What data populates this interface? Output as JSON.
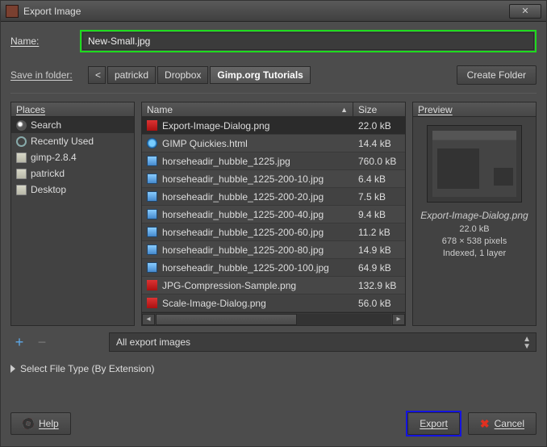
{
  "title": "Export Image",
  "name_label": "Name:",
  "name_value": "New-Small.jpg",
  "save_label": "Save in folder:",
  "breadcrumbs": [
    "patrickd",
    "Dropbox",
    "Gimp.org Tutorials"
  ],
  "create_folder": "Create Folder",
  "places_header": "Places",
  "places": [
    {
      "label": "Search",
      "icon": "search-icon"
    },
    {
      "label": "Recently Used",
      "icon": "recent-icon"
    },
    {
      "label": "gimp-2.8.4",
      "icon": "folder-icon"
    },
    {
      "label": "patrickd",
      "icon": "folder-icon"
    },
    {
      "label": "Desktop",
      "icon": "folder-icon"
    }
  ],
  "file_headers": {
    "name": "Name",
    "size": "Size"
  },
  "files": [
    {
      "name": "Export-Image-Dialog.png",
      "size": "22.0 kB",
      "icon": "ico-png",
      "sel": true
    },
    {
      "name": "GIMP Quickies.html",
      "size": "14.4 kB",
      "icon": "ico-html"
    },
    {
      "name": "horseheadir_hubble_1225.jpg",
      "size": "760.0 kB",
      "icon": "ico-img"
    },
    {
      "name": "horseheadir_hubble_1225-200-10.jpg",
      "size": "6.4 kB",
      "icon": "ico-img"
    },
    {
      "name": "horseheadir_hubble_1225-200-20.jpg",
      "size": "7.5 kB",
      "icon": "ico-img"
    },
    {
      "name": "horseheadir_hubble_1225-200-40.jpg",
      "size": "9.4 kB",
      "icon": "ico-img"
    },
    {
      "name": "horseheadir_hubble_1225-200-60.jpg",
      "size": "11.2 kB",
      "icon": "ico-img"
    },
    {
      "name": "horseheadir_hubble_1225-200-80.jpg",
      "size": "14.9 kB",
      "icon": "ico-img"
    },
    {
      "name": "horseheadir_hubble_1225-200-100.jpg",
      "size": "64.9 kB",
      "icon": "ico-img"
    },
    {
      "name": "JPG-Compression-Sample.png",
      "size": "132.9 kB",
      "icon": "ico-png"
    },
    {
      "name": "Scale-Image-Dialog.png",
      "size": "56.0 kB",
      "icon": "ico-png"
    }
  ],
  "preview": {
    "header": "Preview",
    "name": "Export-Image-Dialog.png",
    "size": "22.0 kB",
    "dims": "678 × 538 pixels",
    "mode": "Indexed, 1 layer"
  },
  "filter": "All export images",
  "filetype": "Select File Type (By Extension)",
  "help": "Help",
  "export": "Export",
  "cancel": "Cancel"
}
